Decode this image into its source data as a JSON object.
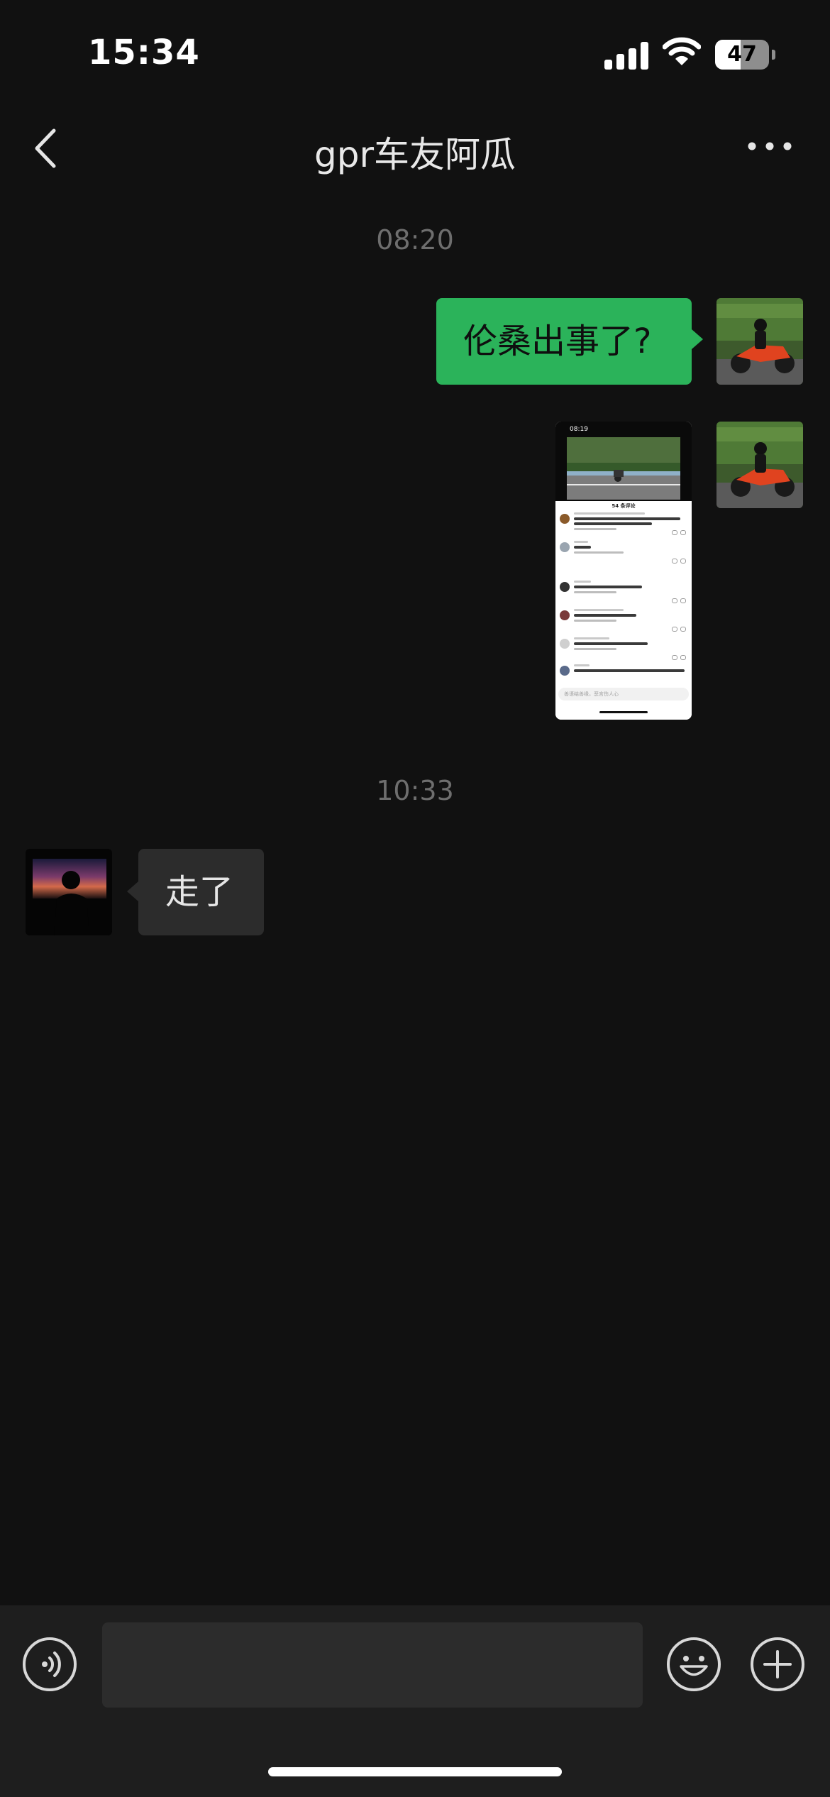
{
  "status_bar": {
    "time": "15:34",
    "battery_level": "47",
    "icons": [
      "signal-icon",
      "wifi-icon",
      "battery-icon"
    ]
  },
  "nav": {
    "title": "gpr车友阿瓜",
    "back_icon": "chevron-left-icon",
    "more_icon": "more-dots-icon"
  },
  "messages": {
    "timestamp_1": "08:20",
    "outgoing_text": "伦桑出事了?",
    "outgoing_screenshot": {
      "status_time": "08:19",
      "comments_header": "54 条评论",
      "input_placeholder": "善语结善缘，恶言伤人心"
    },
    "timestamp_2": "10:33",
    "incoming_text": "走了"
  },
  "input_bar": {
    "voice_icon": "voice-icon",
    "emoji_icon": "emoji-icon",
    "plus_icon": "plus-icon",
    "text_value": ""
  },
  "colors": {
    "background": "#111111",
    "outgoing_bubble": "#2bb35a",
    "incoming_bubble": "#2c2c2c",
    "input_bar": "#1e1e1e"
  }
}
